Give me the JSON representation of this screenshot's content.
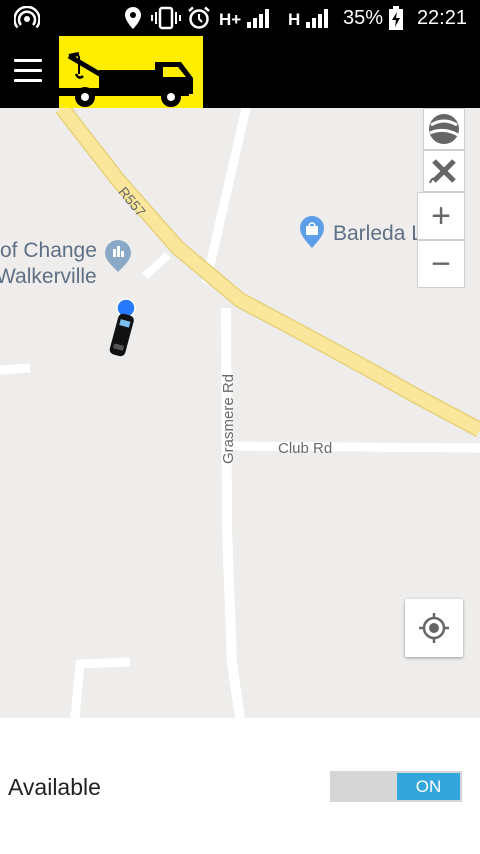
{
  "status_bar": {
    "time": "22:21",
    "battery_percent": "35%",
    "network_1": "H+",
    "network_2": "H",
    "icons": [
      "hotspot-icon",
      "location-icon",
      "vibrate-icon",
      "alarm-icon",
      "signal-icon",
      "signal-icon",
      "battery-charging-icon"
    ]
  },
  "app_bar": {
    "menu_icon": "hamburger-menu-icon",
    "logo_icon": "tow-truck-logo",
    "logo_background": "#ffee00"
  },
  "map": {
    "labels": {
      "road_r557": "R557",
      "grasmere_rd": "Grasmere Rd",
      "club_rd": "Club Rd",
      "poi_left_line1": "of Change",
      "poi_left_line2": "Walkerville",
      "poi_right": "Barleda L"
    },
    "controls": {
      "layers_icon": "globe-icon",
      "satellite_icon": "satellite-icon",
      "zoom_in": "+",
      "zoom_out": "−",
      "my_location_icon": "my-location-icon"
    },
    "colors": {
      "major_road": "#fbe79c",
      "minor_road": "#ffffff",
      "poi_marker": "#5c9ee8",
      "location_dot": "#2979ff"
    }
  },
  "availability": {
    "label": "Available",
    "toggle_state": "ON",
    "toggle_color": "#33a7db"
  }
}
